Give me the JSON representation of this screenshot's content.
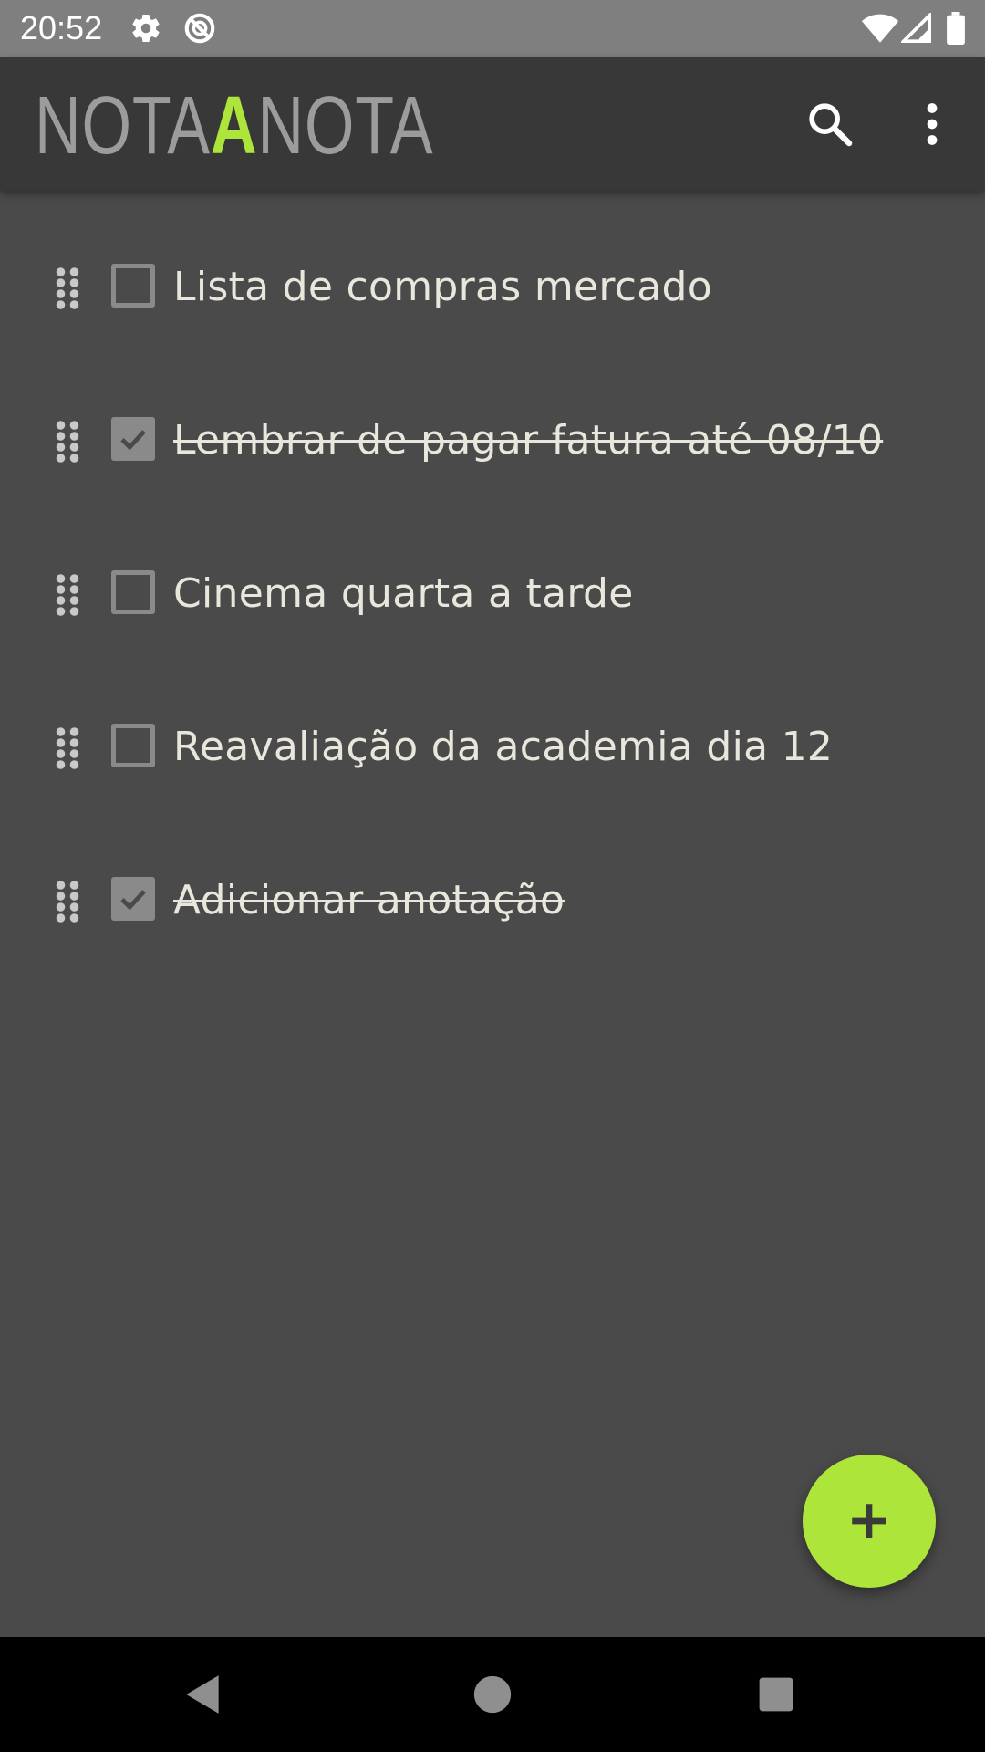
{
  "status_bar": {
    "time": "20:52",
    "icons": [
      "settings-icon",
      "no-disturb-icon",
      "wifi-icon",
      "signal-icon",
      "battery-icon"
    ]
  },
  "app_bar": {
    "logo_left": "NOTA",
    "logo_accent": "A",
    "logo_right": "NOTA",
    "accent_color": "#aee53a",
    "actions": [
      "search-icon",
      "more-vert-icon"
    ]
  },
  "notes": [
    {
      "text": "Lista de compras mercado",
      "checked": false
    },
    {
      "text": "Lembrar de pagar fatura até 08/10",
      "checked": true
    },
    {
      "text": "Cinema quarta a tarde",
      "checked": false
    },
    {
      "text": "Reavaliação da academia dia 12",
      "checked": false
    },
    {
      "text": "Adicionar anotação ",
      "checked": true
    }
  ],
  "fab": {
    "icon": "plus-icon"
  },
  "nav_bar": {
    "buttons": [
      "back-icon",
      "home-icon",
      "recents-icon"
    ]
  }
}
